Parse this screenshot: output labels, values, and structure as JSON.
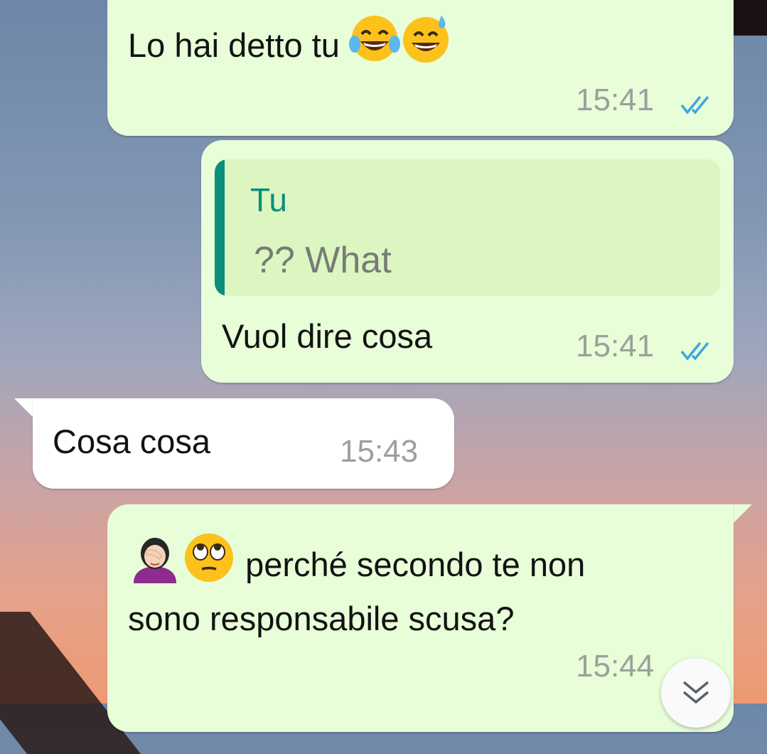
{
  "messages": [
    {
      "direction": "outgoing",
      "text": "Lo hai detto tu",
      "emojis": [
        "face-with-tears-of-joy-icon",
        "grinning-sweat-icon"
      ],
      "time": "15:41",
      "status": "read"
    },
    {
      "direction": "outgoing",
      "quote": {
        "author": "Tu",
        "text": "?? What"
      },
      "text": "Vuol dire cosa",
      "time": "15:41",
      "status": "read"
    },
    {
      "direction": "incoming",
      "text": "Cosa cosa",
      "time": "15:43"
    },
    {
      "direction": "outgoing",
      "emojis": [
        "woman-facepalming-icon",
        "face-with-rolling-eyes-icon"
      ],
      "text_line1": "perché secondo te non",
      "text_line2": "sono responsabile scusa?",
      "time": "15:44",
      "status": "read"
    }
  ],
  "colors": {
    "outgoing_bubble": "#e7fed8",
    "incoming_bubble": "#ffffff",
    "quote_accent": "#0b8e7a",
    "read_ticks": "#3ea6e0"
  },
  "scroll_button": {
    "icon": "double-chevron-down-icon"
  }
}
